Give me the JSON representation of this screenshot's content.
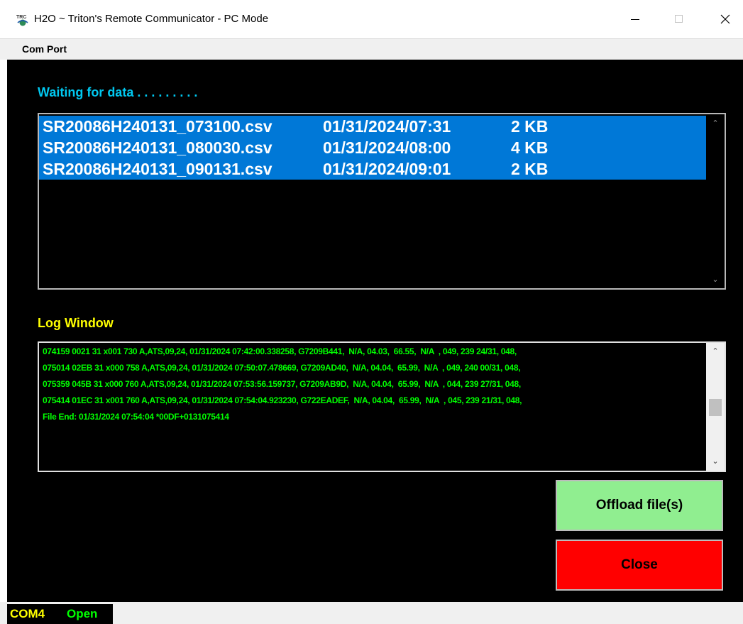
{
  "window": {
    "title": "H2O ~ Triton's Remote Communicator - PC Mode",
    "icon": "triton-app-icon",
    "controls": [
      "minimize-icon",
      "maximize-icon",
      "close-icon"
    ]
  },
  "menu": {
    "items": [
      {
        "label": "Com Port"
      }
    ]
  },
  "waiting_label": "Waiting for data . . . . . . . . .",
  "files": [
    {
      "name": "SR20086H240131_073100.csv",
      "date": "01/31/2024/07:31",
      "size": "2 KB",
      "selected": true
    },
    {
      "name": "SR20086H240131_080030.csv",
      "date": "01/31/2024/08:00",
      "size": "4 KB",
      "selected": true
    },
    {
      "name": "SR20086H240131_090131.csv",
      "date": "01/31/2024/09:01",
      "size": "2 KB",
      "selected": true
    }
  ],
  "log_label": "Log Window",
  "log_lines": [
    "074159 0021 31 x001 730 A,ATS,09,24, 01/31/2024 07:42:00.338258, G7209B441,  N/A, 04.03,  66.55,  N/A  , 049, 239 24/31, 048,",
    "075014 02EB 31 x000 758 A,ATS,09,24, 01/31/2024 07:50:07.478669, G7209AD40,  N/A, 04.04,  65.99,  N/A  , 049, 240 00/31, 048,",
    "075359 045B 31 x000 760 A,ATS,09,24, 01/31/2024 07:53:56.159737, G7209AB9D,  N/A, 04.04,  65.99,  N/A  , 044, 239 27/31, 048,",
    "075414 01EC 31 x001 760 A,ATS,09,24, 01/31/2024 07:54:04.923230, G722EADEF,  N/A, 04.04,  65.99,  N/A  , 045, 239 21/31, 048,",
    "File End: 01/31/2024 07:54:04 *00DF+0131075414"
  ],
  "buttons": {
    "offload": "Offload file(s)",
    "close": "Close"
  },
  "status": {
    "port": "COM4",
    "state": "Open"
  },
  "colors": {
    "background": "#000000",
    "selection": "#0078d7",
    "waiting_text": "#00c8f0",
    "log_label": "#ffff00",
    "log_text": "#00ff00",
    "offload_button": "#90ee90",
    "close_button": "#ff0000"
  }
}
